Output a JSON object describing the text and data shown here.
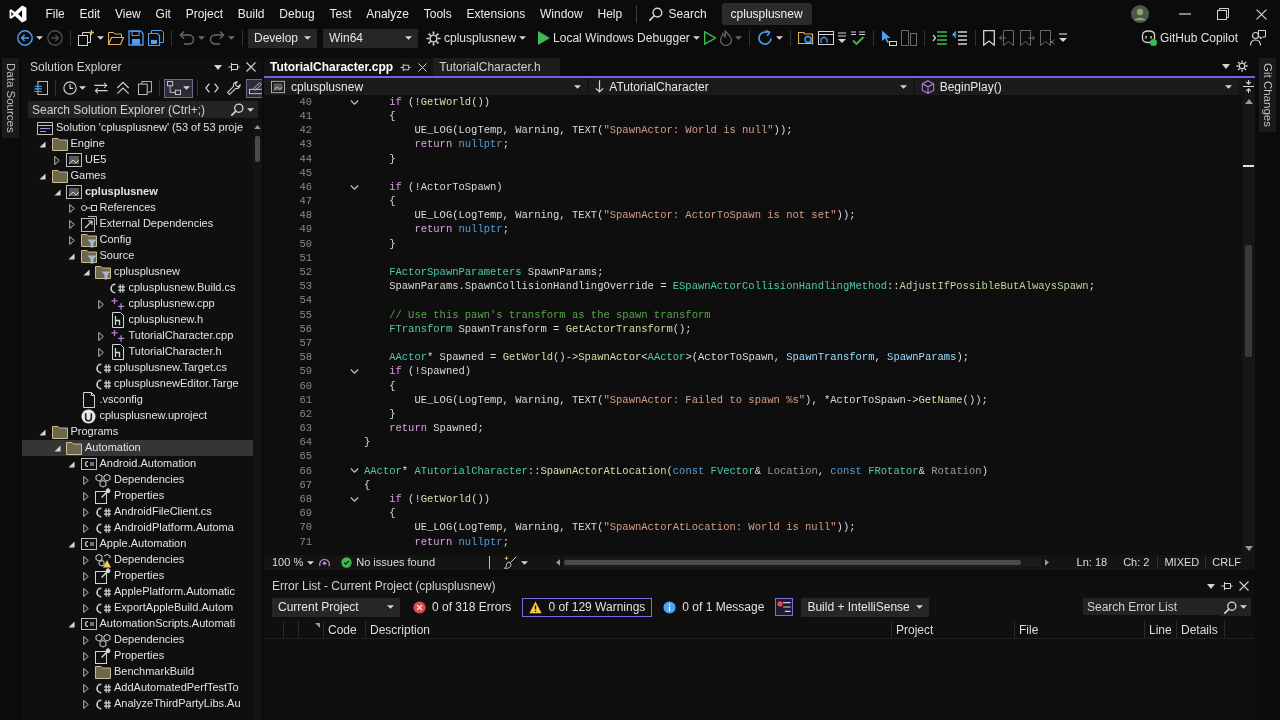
{
  "menu_bar": {
    "menus": [
      "File",
      "Edit",
      "View",
      "Git",
      "Project",
      "Build",
      "Debug",
      "Test",
      "Analyze",
      "Tools",
      "Extensions",
      "Window",
      "Help"
    ],
    "search": "Search",
    "solution_title": "cplusplusnew"
  },
  "toolbar": {
    "groups": [
      [
        {
          "kind": "back",
          "disabled": false,
          "menu": true
        },
        {
          "kind": "forward",
          "disabled": true
        }
      ],
      [
        {
          "kind": "new-item",
          "disabled": false,
          "menu": true
        },
        {
          "kind": "open",
          "disabled": false
        },
        {
          "kind": "save",
          "disabled": false
        },
        {
          "kind": "save-all",
          "disabled": false
        }
      ],
      [
        {
          "kind": "undo",
          "disabled": true,
          "menu": true
        },
        {
          "kind": "redo",
          "disabled": true,
          "menu": true
        }
      ],
      [
        {
          "kind": "combo",
          "value": "Develop",
          "disabled": false,
          "menu": true
        },
        {
          "kind": "combo",
          "value": "Win64",
          "disabled": false,
          "menu": true
        },
        {
          "kind": "startup",
          "label": "cplusplusnew",
          "disabled": false,
          "menu": true
        },
        {
          "kind": "run",
          "label": "Local Windows Debugger",
          "disabled": false,
          "menu": true
        },
        {
          "kind": "run-without-debugging",
          "disabled": false
        },
        {
          "kind": "hot-reload",
          "disabled": true,
          "menu": true
        }
      ],
      [
        {
          "kind": "restart",
          "disabled": false,
          "menu": true
        }
      ],
      [
        {
          "kind": "folder-search",
          "disabled": false
        },
        {
          "kind": "window",
          "disabled": false
        },
        {
          "kind": "list-menu",
          "disabled": false
        },
        {
          "kind": "spell-check",
          "disabled": false
        }
      ],
      [
        {
          "kind": "pointer",
          "disabled": false
        },
        {
          "kind": "panels",
          "disabled": true
        }
      ],
      [
        {
          "kind": "indent",
          "disabled": false
        },
        {
          "kind": "outdent",
          "disabled": false
        }
      ],
      [
        {
          "kind": "bookmark",
          "disabled": false
        },
        {
          "kind": "bookmark-prev",
          "disabled": true
        },
        {
          "kind": "bookmark-next",
          "disabled": true
        },
        {
          "kind": "bookmark-clear",
          "disabled": true
        },
        {
          "kind": "overflow",
          "disabled": false
        }
      ]
    ],
    "copilot": "GitHub Copilot"
  },
  "left_strip": {
    "tab": "Data Sources"
  },
  "solution_explorer": {
    "title": "Solution Explorer",
    "toolbar": [
      [
        {
          "kind": "switch-views",
          "on": false
        }
      ],
      [
        {
          "kind": "history",
          "on": false,
          "menu": true
        },
        {
          "kind": "sync",
          "on": false
        },
        {
          "kind": "collapse-all",
          "on": false
        },
        {
          "kind": "copy",
          "on": false
        }
      ],
      [
        {
          "kind": "show-all-files",
          "on": true,
          "menu": true
        }
      ],
      [
        {
          "kind": "code",
          "on": false
        },
        {
          "kind": "properties",
          "on": false
        },
        {
          "kind": "preview",
          "on": true
        }
      ]
    ],
    "search": {
      "placeholder": "Search Solution Explorer (Ctrl+;)"
    },
    "tree": [
      {
        "label": "Solution 'cplusplusnew' (53 of 53 proje",
        "kind": "solution",
        "selected": false,
        "children": [
          {
            "label": "Engine",
            "kind": "folder",
            "expanded": true,
            "selected": false,
            "children": [
              {
                "label": "UE5",
                "kind": "project",
                "expanded": false,
                "selected": false
              }
            ]
          },
          {
            "label": "Games",
            "kind": "folder",
            "expanded": true,
            "selected": false,
            "children": [
              {
                "label": "cplusplusnew",
                "kind": "startup-project",
                "expanded": true,
                "selected": false,
                "children": [
                  {
                    "label": "References",
                    "kind": "references",
                    "expanded": false,
                    "selected": false
                  },
                  {
                    "label": "External Dependencies",
                    "kind": "external",
                    "expanded": false,
                    "selected": false
                  },
                  {
                    "label": "Config",
                    "kind": "filter",
                    "expanded": false,
                    "selected": false
                  },
                  {
                    "label": "Source",
                    "kind": "filter",
                    "expanded": true,
                    "selected": false,
                    "children": [
                      {
                        "label": "cplusplusnew",
                        "kind": "filter",
                        "expanded": true,
                        "selected": false,
                        "children": [
                          {
                            "label": "cplusplusnew.Build.cs",
                            "kind": "cs-file",
                            "selected": false
                          },
                          {
                            "label": "cplusplusnew.cpp",
                            "kind": "cpp-file",
                            "expanded": false,
                            "selected": false
                          },
                          {
                            "label": "cplusplusnew.h",
                            "kind": "header-file",
                            "selected": false
                          },
                          {
                            "label": "TutorialCharacter.cpp",
                            "kind": "cpp-file",
                            "expanded": false,
                            "selected": false
                          },
                          {
                            "label": "TutorialCharacter.h",
                            "kind": "header-file",
                            "expanded": false,
                            "selected": false
                          }
                        ]
                      },
                      {
                        "label": "cplusplusnew.Target.cs",
                        "kind": "cs-file",
                        "selected": false
                      },
                      {
                        "label": "cplusplusnewEditor.Targe",
                        "kind": "cs-file",
                        "selected": false
                      }
                    ]
                  },
                  {
                    "label": ".vsconfig",
                    "kind": "config-file",
                    "selected": false
                  },
                  {
                    "label": "cplusplusnew.uproject",
                    "kind": "uproject",
                    "selected": false
                  }
                ]
              }
            ]
          },
          {
            "label": "Programs",
            "kind": "folder",
            "expanded": true,
            "selected": false,
            "children": [
              {
                "label": "Automation",
                "kind": "folder",
                "expanded": true,
                "selected": true,
                "children": [
                  {
                    "label": "Android.Automation",
                    "kind": "cs-project",
                    "expanded": true,
                    "selected": false,
                    "children": [
                      {
                        "label": "Dependencies",
                        "kind": "dependencies",
                        "expanded": false,
                        "selected": false
                      },
                      {
                        "label": "Properties",
                        "kind": "properties",
                        "expanded": false,
                        "selected": false
                      },
                      {
                        "label": "AndroidFileClient.cs",
                        "kind": "cs-file",
                        "expanded": false,
                        "selected": false
                      },
                      {
                        "label": "AndroidPlatform.Automa",
                        "kind": "cs-file",
                        "expanded": false,
                        "selected": false
                      }
                    ]
                  },
                  {
                    "label": "Apple.Automation",
                    "kind": "cs-project",
                    "expanded": true,
                    "selected": false,
                    "children": [
                      {
                        "label": "Dependencies",
                        "kind": "dependencies-warning",
                        "expanded": false,
                        "selected": false
                      },
                      {
                        "label": "Properties",
                        "kind": "properties",
                        "expanded": false,
                        "selected": false
                      },
                      {
                        "label": "ApplePlatform.Automatic",
                        "kind": "cs-file",
                        "expanded": false,
                        "selected": false
                      },
                      {
                        "label": "ExportAppleBuild.Autom",
                        "kind": "cs-file",
                        "expanded": false,
                        "selected": false
                      }
                    ]
                  },
                  {
                    "label": "AutomationScripts.Automati",
                    "kind": "cs-project",
                    "expanded": true,
                    "selected": false,
                    "children": [
                      {
                        "label": "Dependencies",
                        "kind": "dependencies",
                        "expanded": false,
                        "selected": false
                      },
                      {
                        "label": "Properties",
                        "kind": "properties",
                        "expanded": false,
                        "selected": false
                      },
                      {
                        "label": "BenchmarkBuild",
                        "kind": "folder",
                        "expanded": false,
                        "selected": false
                      },
                      {
                        "label": "AddAutomatedPerfTestTo",
                        "kind": "cs-file",
                        "expanded": false,
                        "selected": false
                      },
                      {
                        "label": "AnalyzeThirdPartyLibs.Au",
                        "kind": "cs-file",
                        "expanded": false,
                        "selected": false
                      }
                    ]
                  }
                ]
              }
            ]
          }
        ]
      }
    ]
  },
  "editor": {
    "tabs": [
      {
        "label": "TutorialCharacter.cpp",
        "selected": true
      },
      {
        "label": "TutorialCharacter.h",
        "selected": false
      }
    ],
    "navigation": {
      "project": "cplusplusnew",
      "scope": "ATutorialCharacter",
      "member": "BeginPlay()"
    },
    "lines": [
      {
        "number": "40",
        "fold": true,
        "tokens": [
          {
            "text": "if",
            "kind": "control"
          },
          {
            "text": " (!",
            "kind": "plain"
          },
          {
            "text": "GetWorld",
            "kind": "function"
          },
          {
            "text": "())",
            "kind": "plain"
          }
        ]
      },
      {
        "number": "41",
        "fold": false,
        "tokens": [
          {
            "text": "{",
            "kind": "plain"
          }
        ]
      },
      {
        "number": "42",
        "fold": false,
        "tokens": [
          {
            "text": "UE_LOG(LogTemp, Warning, TEXT(",
            "kind": "plain"
          },
          {
            "text": "\"SpawnActor: World is null\"",
            "kind": "string"
          },
          {
            "text": "));",
            "kind": "plain"
          }
        ]
      },
      {
        "number": "43",
        "fold": false,
        "tokens": [
          {
            "text": "return ",
            "kind": "control"
          },
          {
            "text": "nullptr",
            "kind": "keyword"
          },
          {
            "text": ";",
            "kind": "plain"
          }
        ]
      },
      {
        "number": "44",
        "fold": false,
        "tokens": [
          {
            "text": "}",
            "kind": "plain"
          }
        ]
      },
      {
        "number": "45",
        "fold": false
      },
      {
        "number": "46",
        "fold": true,
        "tokens": [
          {
            "text": "if",
            "kind": "control"
          },
          {
            "text": " (!ActorToSpawn)",
            "kind": "plain"
          }
        ]
      },
      {
        "number": "47",
        "fold": false,
        "tokens": [
          {
            "text": "{",
            "kind": "plain"
          }
        ]
      },
      {
        "number": "48",
        "fold": false,
        "tokens": [
          {
            "text": "UE_LOG(LogTemp, Warning, TEXT(",
            "kind": "plain"
          },
          {
            "text": "\"SpawnActor: ActorToSpawn is not set\"",
            "kind": "string"
          },
          {
            "text": "));",
            "kind": "plain"
          }
        ]
      },
      {
        "number": "49",
        "fold": false,
        "tokens": [
          {
            "text": "return ",
            "kind": "control"
          },
          {
            "text": "nullptr",
            "kind": "keyword"
          },
          {
            "text": ";",
            "kind": "plain"
          }
        ]
      },
      {
        "number": "50",
        "fold": false,
        "tokens": [
          {
            "text": "}",
            "kind": "plain"
          }
        ]
      },
      {
        "number": "51",
        "fold": false
      },
      {
        "number": "52",
        "fold": false,
        "tokens": [
          {
            "text": "FActorSpawnParameters",
            "kind": "type"
          },
          {
            "text": " SpawnParams;",
            "kind": "plain"
          }
        ]
      },
      {
        "number": "53",
        "fold": false,
        "tokens": [
          {
            "text": "SpawnParams.SpawnCollisionHandlingOverride = ",
            "kind": "plain"
          },
          {
            "text": "ESpawnActorCollisionHandlingMethod",
            "kind": "type"
          },
          {
            "text": "::",
            "kind": "plain"
          },
          {
            "text": "AdjustIfPossibleButAlwaysSpawn",
            "kind": "enum"
          },
          {
            "text": ";",
            "kind": "plain"
          }
        ]
      },
      {
        "number": "54",
        "fold": false
      },
      {
        "number": "55",
        "fold": false,
        "tokens": [
          {
            "text": "// Use this pawn's transform as the spawn transform",
            "kind": "comment"
          }
        ]
      },
      {
        "number": "56",
        "fold": false,
        "tokens": [
          {
            "text": "FTransform",
            "kind": "type"
          },
          {
            "text": " SpawnTransform = ",
            "kind": "plain"
          },
          {
            "text": "GetActorTransform",
            "kind": "function"
          },
          {
            "text": "();",
            "kind": "plain"
          }
        ]
      },
      {
        "number": "57",
        "fold": false
      },
      {
        "number": "58",
        "fold": false,
        "tokens": [
          {
            "text": "AActor",
            "kind": "type"
          },
          {
            "text": "* Spawned = ",
            "kind": "plain"
          },
          {
            "text": "GetWorld",
            "kind": "function"
          },
          {
            "text": "()->",
            "kind": "plain"
          },
          {
            "text": "SpawnActor",
            "kind": "function"
          },
          {
            "text": "<",
            "kind": "plain"
          },
          {
            "text": "AActor",
            "kind": "type"
          },
          {
            "text": ">(ActorToSpawn, ",
            "kind": "plain"
          },
          {
            "text": "SpawnTransform",
            "kind": "local"
          },
          {
            "text": ", ",
            "kind": "plain"
          },
          {
            "text": "SpawnParams",
            "kind": "local"
          },
          {
            "text": ");",
            "kind": "plain"
          }
        ]
      },
      {
        "number": "59",
        "fold": true,
        "tokens": [
          {
            "text": "if",
            "kind": "control"
          },
          {
            "text": " (!Spawned)",
            "kind": "plain"
          }
        ]
      },
      {
        "number": "60",
        "fold": false,
        "tokens": [
          {
            "text": "{",
            "kind": "plain"
          }
        ]
      },
      {
        "number": "61",
        "fold": false,
        "tokens": [
          {
            "text": "UE_LOG(LogTemp, Warning, TEXT(",
            "kind": "plain"
          },
          {
            "text": "\"SpawnActor: Failed to spawn %s\"",
            "kind": "string"
          },
          {
            "text": "), *ActorToSpawn->",
            "kind": "plain"
          },
          {
            "text": "GetName",
            "kind": "function"
          },
          {
            "text": "());",
            "kind": "plain"
          }
        ]
      },
      {
        "number": "62",
        "fold": false,
        "tokens": [
          {
            "text": "}",
            "kind": "plain"
          }
        ]
      },
      {
        "number": "63",
        "fold": false,
        "tokens": [
          {
            "text": "return",
            "kind": "control"
          },
          {
            "text": " Spawned;",
            "kind": "plain"
          }
        ]
      },
      {
        "number": "64",
        "fold": false,
        "tokens": [
          {
            "text": "}",
            "kind": "plain"
          }
        ]
      },
      {
        "number": "65",
        "fold": false
      },
      {
        "number": "66",
        "fold": true,
        "tokens": [
          {
            "text": "AActor",
            "kind": "type"
          },
          {
            "text": "* ",
            "kind": "plain"
          },
          {
            "text": "ATutorialCharacter",
            "kind": "type"
          },
          {
            "text": "::",
            "kind": "plain"
          },
          {
            "text": "SpawnActorAtLocation",
            "kind": "function"
          },
          {
            "text": "(",
            "kind": "plain"
          },
          {
            "text": "const ",
            "kind": "keyword"
          },
          {
            "text": "FVector",
            "kind": "type"
          },
          {
            "text": "& ",
            "kind": "plain"
          },
          {
            "text": "Location",
            "kind": "param"
          },
          {
            "text": ", ",
            "kind": "plain"
          },
          {
            "text": "const ",
            "kind": "keyword"
          },
          {
            "text": "FRotator",
            "kind": "type"
          },
          {
            "text": "& ",
            "kind": "plain"
          },
          {
            "text": "Rotation",
            "kind": "param"
          },
          {
            "text": ")",
            "kind": "plain"
          }
        ]
      },
      {
        "number": "67",
        "fold": false,
        "tokens": [
          {
            "text": "{",
            "kind": "plain"
          }
        ]
      },
      {
        "number": "68",
        "fold": true,
        "tokens": [
          {
            "text": "if",
            "kind": "control"
          },
          {
            "text": " (!",
            "kind": "plain"
          },
          {
            "text": "GetWorld",
            "kind": "function"
          },
          {
            "text": "())",
            "kind": "plain"
          }
        ]
      },
      {
        "number": "69",
        "fold": false,
        "tokens": [
          {
            "text": "{",
            "kind": "plain"
          }
        ]
      },
      {
        "number": "70",
        "fold": false,
        "tokens": [
          {
            "text": "UE_LOG(LogTemp, Warning, TEXT(",
            "kind": "plain"
          },
          {
            "text": "\"SpawnActorAtLocation: World is null\"",
            "kind": "string"
          },
          {
            "text": "));",
            "kind": "plain"
          }
        ]
      },
      {
        "number": "71",
        "fold": false,
        "tokens": [
          {
            "text": "return ",
            "kind": "control"
          },
          {
            "text": "nullptr",
            "kind": "keyword"
          },
          {
            "text": ";",
            "kind": "plain"
          }
        ]
      }
    ],
    "status": {
      "zoom": "100 %",
      "issues": "No issues found",
      "line": "Ln: 18",
      "column": "Ch: 2",
      "whitespace": "MIXED",
      "line_endings": "CRLF"
    }
  },
  "error_list": {
    "title": "Error List - Current Project (cplusplusnew)",
    "scope": "Current Project",
    "filters": [
      {
        "kind": "error",
        "label": "0 of 318 Errors",
        "selected": false
      },
      {
        "kind": "warning",
        "label": "0 of 129 Warnings",
        "selected": true
      },
      {
        "kind": "message",
        "label": "0 of 1 Message",
        "selected": false
      }
    ],
    "filter_toggle": {
      "on": true
    },
    "source": "Build + IntelliSense",
    "search": {
      "placeholder": "Search Error List"
    },
    "columns": [
      "Code",
      "Description",
      "Project",
      "File",
      "Line",
      "Details"
    ]
  },
  "right_strip": {
    "tab": "Git Changes"
  }
}
